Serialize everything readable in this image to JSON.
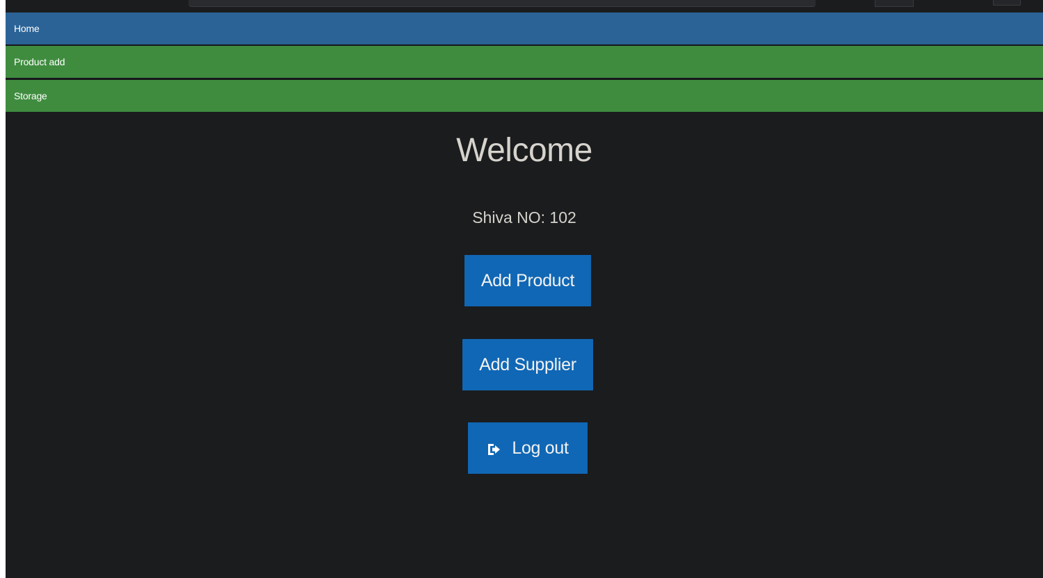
{
  "nav": {
    "home": "Home",
    "product_add": "Product add",
    "storage": "Storage"
  },
  "main": {
    "title": "Welcome",
    "user_line": "Shiva NO: 102",
    "buttons": {
      "add_product": "Add Product",
      "add_supplier": "Add Supplier",
      "log_out": "Log out"
    }
  },
  "icons": {
    "logout": "sign-out-icon"
  },
  "colors": {
    "background": "#1b1c1e",
    "home_nav": "#2b6396",
    "green_nav": "#3f8c3f",
    "button": "#1067b5",
    "text": "#d6d3cd"
  }
}
